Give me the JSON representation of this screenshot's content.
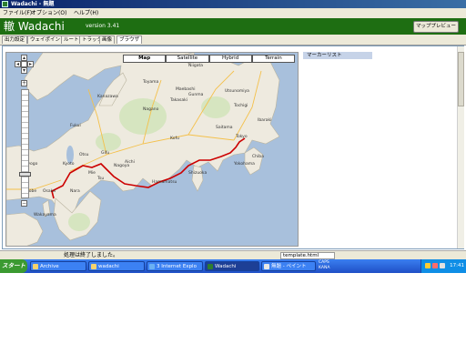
{
  "window": {
    "title": "Wadachi - 無題"
  },
  "menu": [
    "ファイル(F)",
    "オプション(O)",
    "ヘルプ(H)"
  ],
  "header": {
    "app_name": "轍 Wadachi",
    "version": "version 3.41",
    "map_preview_button": "マッププレビュー"
  },
  "tabs": [
    "出力設定",
    "ウェイポイント",
    "ルート",
    "トラック",
    "画像",
    "ブラウザ"
  ],
  "map": {
    "types": [
      "Map",
      "Satellite",
      "Hybrid",
      "Terrain"
    ],
    "selected_type": "Map",
    "labels": [
      "Toyama",
      "Nagano",
      "Gunma",
      "Takasaki",
      "Niigata",
      "Maebashi",
      "Utsunomiya",
      "Fukui",
      "Gifu",
      "Nagoya",
      "Kofu",
      "Tokyo",
      "Yokohama",
      "Chiba",
      "Shizuoka",
      "Hamamatsu",
      "Kyoto",
      "Osaka",
      "Kobe",
      "Nara",
      "Wakayama",
      "Tsu",
      "Otsu",
      "Hyogo",
      "Mie",
      "Aichi",
      "Saitama",
      "Ibaraki",
      "Tochigi",
      "Kanazawa"
    ]
  },
  "marker_list": {
    "title": "マーカーリスト"
  },
  "status": {
    "message": "処理は終了しました。",
    "file": "template.html"
  },
  "taskbar": {
    "start": "スタート",
    "items": [
      {
        "label": "Archive",
        "active": false
      },
      {
        "label": "wadachi",
        "active": false
      },
      {
        "label": "3 Internet Explo",
        "active": false
      },
      {
        "label": "Wadachi",
        "active": true
      },
      {
        "label": "無題 - ペイント",
        "active": false
      }
    ],
    "lang": [
      "CAPS",
      "KANA"
    ],
    "clock": "17:41"
  },
  "colors": {
    "header_bg": "#1e6e12",
    "route": "#cc0000",
    "sea": "#a8c0dc",
    "land": "#eeeadf"
  }
}
